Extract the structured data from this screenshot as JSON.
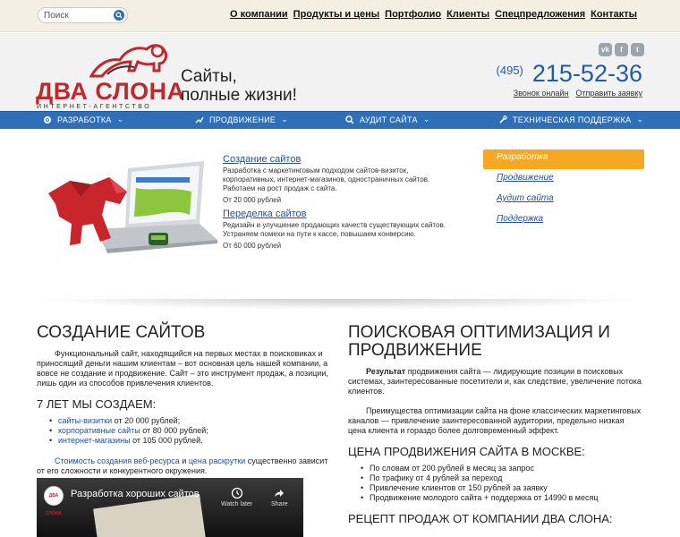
{
  "search": {
    "placeholder": "Поиск"
  },
  "topnav": [
    "О компании",
    "Продукты и цены",
    "Портфолио",
    "Клиенты",
    "Спецпредложения",
    "Контакты"
  ],
  "logo": {
    "name": "ДВА СЛОНА",
    "sub": "ИНТЕРНЕТ-АГЕНТСТВО"
  },
  "tagline": {
    "line1": "Сайты,",
    "line2": "полные жизни!"
  },
  "social": [
    "vk",
    "f",
    "t"
  ],
  "contacts": {
    "code": "(495)",
    "phone": "215-52-36",
    "call_online": "Звонок онлайн",
    "send_request": "Отправить заявку"
  },
  "mainnav": [
    "РАЗРАБОТКА",
    "ПРОДВИЖЕНИЕ",
    "АУДИТ САЙТА",
    "ТЕХНИЧЕСКАЯ ПОДДЕРЖКА"
  ],
  "hero": {
    "services": [
      {
        "title": "Создание сайтов",
        "desc": "Разработка с маркетинговым подходом сайтов-визиток, корпоративных, интернет-магазинов, одностраничных сайтов. Работаем на рост продаж с сайта.",
        "price": "От 20 000 рублей"
      },
      {
        "title": "Переделка сайтов",
        "desc": "Редизайн и улучшение продающих качеств существующих сайтов. Устраняем помехи на пути к кассе, повышаем конверсию.",
        "price": "От 60 000 рублей"
      }
    ],
    "side_menu": [
      "Разработка",
      "Продвижение",
      "Аудит сайта",
      "Поддержка"
    ]
  },
  "left": {
    "title": "СОЗДАНИЕ САЙТОВ",
    "intro": "Функциональный сайт, находящийся на первых местах в поисковиках и приносящий деньги нашим клиентам – вот основная цель нашей компании, а вовсе не создание и продвижение. Сайт – это инструмент продаж, а позиции, лишь один из способов привлечения клиентов.",
    "subtitle": "7 ЛЕТ МЫ СОЗДАЕМ:",
    "items": [
      {
        "link": "сайты-визитки",
        "text": " от 20 000 рублей;"
      },
      {
        "link": "корпоративные сайты",
        "text": " от 80 000 рублей;"
      },
      {
        "link": "интернет-магазины",
        "text": " от 105 000 рублей."
      }
    ],
    "cost_link1": "Стоимость создания веб-ресурса",
    "cost_and": " и ",
    "cost_link2": "цена раскрутки",
    "cost_text": " существенно зависит от его сложности и конкурентного окружения.",
    "video": {
      "title": "Разработка хороших сайтов",
      "watch_later": "Watch later",
      "share": "Share",
      "channel": "ДВА СЛОНА"
    }
  },
  "right": {
    "title": "ПОИСКОВАЯ ОПТИМИЗАЦИЯ И ПРОДВИЖЕНИЕ",
    "result_bold": "Результат",
    "result_text": " продвижения сайта — лидирующие позиции в поисковых системах, заинтересованные посетители и, как следствие, увеличение потока клиентов.",
    "advantages": "Преимущества оптимизации сайта на фоне классических маркетинговых каналов — привлечение заинтересованной аудитории, предельно низкая цена клиента и гораздо более долговременный эффект.",
    "price_title": "ЦЕНА ПРОДВИЖЕНИЯ САЙТА В МОСКВЕ:",
    "price_items": [
      "По словам от 200 рублей в месяц за запрос",
      "По трафику от 4 рублей за переход",
      "Привлечение клиентов от 150 рублей за заявку",
      "Продвижение молодого сайта + поддержка от 14990 в месяц"
    ],
    "recipe_title": "РЕЦЕПТ ПРОДАЖ ОТ КОМПАНИИ ДВА СЛОНА:"
  },
  "colors": {
    "brand_red": "#c0282d",
    "nav_blue": "#2f6fb7",
    "phone_blue": "#1f5ca8",
    "active_orange": "#f7a823"
  }
}
